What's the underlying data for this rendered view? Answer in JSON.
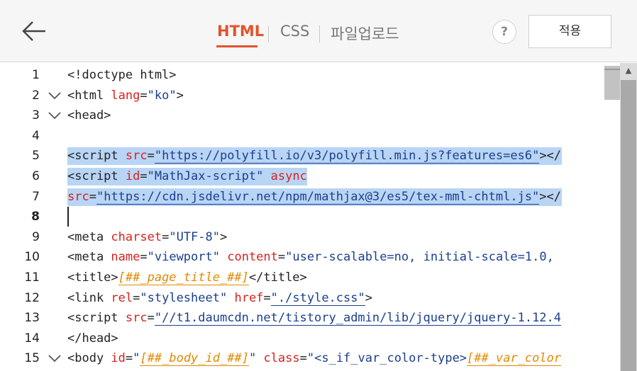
{
  "header": {
    "tabs": [
      {
        "label": "HTML",
        "active": true
      },
      {
        "label": "CSS",
        "active": false
      },
      {
        "label": "파일업로드",
        "active": false
      }
    ],
    "help_label": "?",
    "apply_label": "적용",
    "accent_color": "#e0542c"
  },
  "editor": {
    "line_numbers": [
      "1",
      "2",
      "3",
      "4",
      "5",
      "6",
      "7",
      "8",
      "9",
      "10",
      "11",
      "12",
      "13",
      "14",
      "15"
    ],
    "selected_lines": [
      5,
      6,
      7
    ],
    "cursor_line": 8,
    "folded_lines": [
      2,
      3,
      15
    ],
    "lines": [
      [
        {
          "c": "t",
          "x": "<!doctype html>"
        }
      ],
      [
        {
          "c": "t",
          "x": "<html "
        },
        {
          "c": "a",
          "x": "lang"
        },
        {
          "c": "t",
          "x": "="
        },
        {
          "c": "s",
          "x": "\"ko\""
        },
        {
          "c": "t",
          "x": ">"
        }
      ],
      [
        {
          "c": "t",
          "x": "<head>"
        }
      ],
      [],
      [
        {
          "c": "t",
          "x": "<script "
        },
        {
          "c": "a",
          "x": "src"
        },
        {
          "c": "t",
          "x": "="
        },
        {
          "c": "s",
          "x": "\"https://polyfill.io/v3/polyfill.min.js?features=es6\"",
          "u": true
        },
        {
          "c": "t",
          "x": "></"
        }
      ],
      [
        {
          "c": "t",
          "x": "<script "
        },
        {
          "c": "a",
          "x": "id"
        },
        {
          "c": "t",
          "x": "="
        },
        {
          "c": "s",
          "x": "\"MathJax-script\""
        },
        {
          "c": "t",
          "x": " "
        },
        {
          "c": "a",
          "x": "async"
        }
      ],
      [
        {
          "c": "a",
          "x": "src"
        },
        {
          "c": "t",
          "x": "="
        },
        {
          "c": "s",
          "x": "\"https://cdn.jsdelivr.net/npm/mathjax@3/es5/tex-mml-chtml.js\"",
          "u": true
        },
        {
          "c": "t",
          "x": "></"
        }
      ],
      [],
      [
        {
          "c": "t",
          "x": "<meta "
        },
        {
          "c": "a",
          "x": "charset"
        },
        {
          "c": "t",
          "x": "="
        },
        {
          "c": "s",
          "x": "\"UTF-8\""
        },
        {
          "c": "t",
          "x": ">"
        }
      ],
      [
        {
          "c": "t",
          "x": "<meta "
        },
        {
          "c": "a",
          "x": "name"
        },
        {
          "c": "t",
          "x": "="
        },
        {
          "c": "s",
          "x": "\"viewport\""
        },
        {
          "c": "t",
          "x": " "
        },
        {
          "c": "a",
          "x": "content"
        },
        {
          "c": "t",
          "x": "="
        },
        {
          "c": "s",
          "x": "\"user-scalable=no, initial-scale=1.0,"
        }
      ],
      [
        {
          "c": "t",
          "x": "<title>"
        },
        {
          "c": "v",
          "x": "[##_page_title_##]",
          "u": true
        },
        {
          "c": "t",
          "x": "</title>"
        }
      ],
      [
        {
          "c": "t",
          "x": "<link "
        },
        {
          "c": "a",
          "x": "rel"
        },
        {
          "c": "t",
          "x": "="
        },
        {
          "c": "s",
          "x": "\"stylesheet\""
        },
        {
          "c": "t",
          "x": " "
        },
        {
          "c": "a",
          "x": "href"
        },
        {
          "c": "t",
          "x": "="
        },
        {
          "c": "s",
          "x": "\"./style.css\"",
          "u": true
        },
        {
          "c": "t",
          "x": ">"
        }
      ],
      [
        {
          "c": "t",
          "x": "<script "
        },
        {
          "c": "a",
          "x": "src"
        },
        {
          "c": "t",
          "x": "="
        },
        {
          "c": "s",
          "x": "\"//t1.daumcdn.net/tistory_admin/lib/jquery/jquery-1.12.4",
          "u": true
        }
      ],
      [
        {
          "c": "t",
          "x": "</head>"
        }
      ],
      [
        {
          "c": "t",
          "x": "<body "
        },
        {
          "c": "a",
          "x": "id"
        },
        {
          "c": "t",
          "x": "="
        },
        {
          "c": "s",
          "x": "\""
        },
        {
          "c": "v",
          "x": "[##_body_id_##]",
          "u": true
        },
        {
          "c": "s",
          "x": "\""
        },
        {
          "c": "t",
          "x": " "
        },
        {
          "c": "a",
          "x": "class"
        },
        {
          "c": "t",
          "x": "="
        },
        {
          "c": "s",
          "x": "\"<s_if_var_color-type>"
        },
        {
          "c": "v",
          "x": "[##_var_color",
          "u": true
        }
      ]
    ]
  }
}
